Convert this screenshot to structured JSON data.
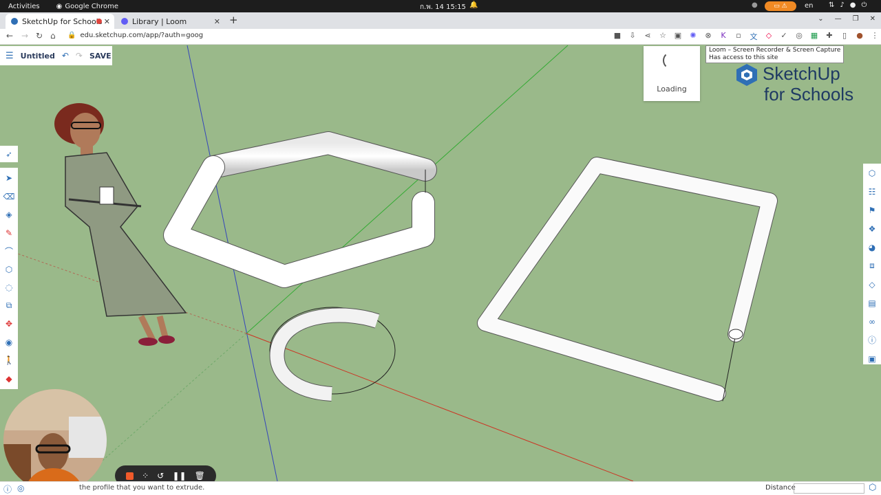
{
  "gnome": {
    "activities": "Activities",
    "app_name": "Google Chrome",
    "clock": "ก.พ. 14  15:15",
    "lang": "en"
  },
  "tabs": [
    {
      "title": "SketchUp for Schools"
    },
    {
      "title": "Library | Loom"
    }
  ],
  "toolbar": {
    "url": "edu.sketchup.com/app/?auth=goog"
  },
  "sketchup": {
    "file_title": "Untitled",
    "save_label": "SAVE"
  },
  "loom": {
    "tooltip_line1": "Loom – Screen Recorder & Screen Capture",
    "tooltip_line2": "Has access to this site",
    "loading": "Loading"
  },
  "logo": {
    "line1": "SketchUp",
    "line2": "for Schools"
  },
  "status": {
    "hint": "the profile that you want to extrude.",
    "distance_label": "Distance",
    "distance_value": ""
  },
  "colors": {
    "canvas": "#9ab98a",
    "sketchup_blue": "#2f6fb5",
    "record_orange": "#f05a2a"
  },
  "icons": {
    "left_tools": [
      "select-icon",
      "eraser-icon",
      "paint-bucket-icon",
      "pencil-icon",
      "arc-icon",
      "shape-icon",
      "offset-icon",
      "push-pull-icon",
      "move-icon",
      "tape-measure-icon",
      "walk-icon",
      "section-plane-icon"
    ],
    "right_panel": [
      "entity-info-icon",
      "layers-icon",
      "outliner-icon",
      "components-icon",
      "materials-icon",
      "styles-icon",
      "tags-icon",
      "scenes-icon",
      "views-icon",
      "instructor-icon",
      "display-icon"
    ]
  }
}
